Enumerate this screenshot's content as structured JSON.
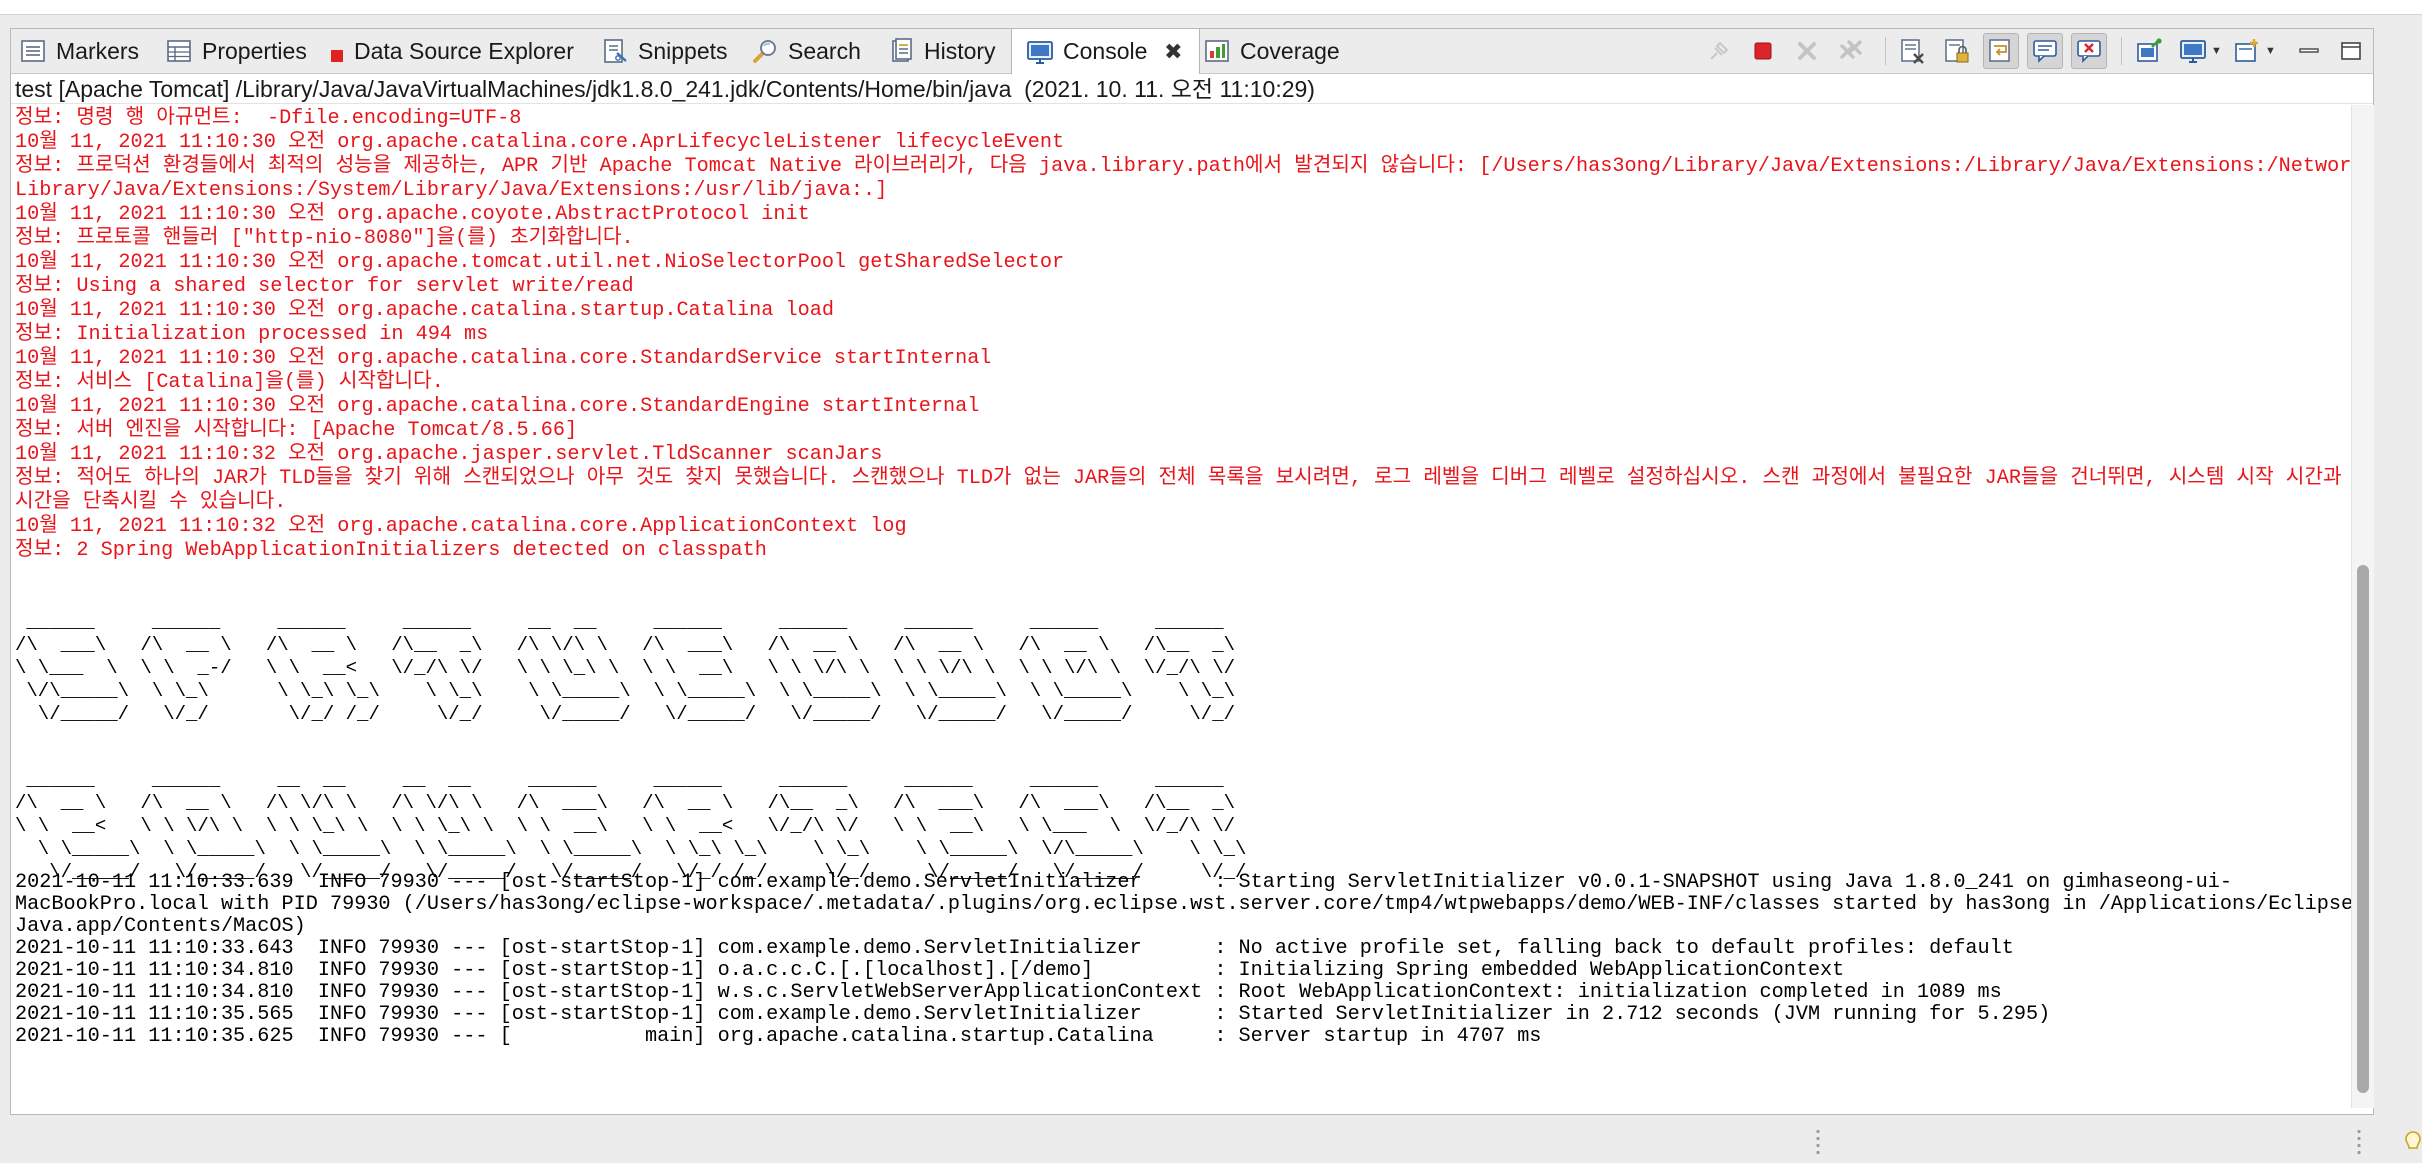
{
  "tabs": [
    {
      "label": "Markers",
      "icon": "markers-icon"
    },
    {
      "label": "Properties",
      "icon": "properties-icon"
    },
    {
      "label": "Data Source Explorer",
      "icon": "data-source-explorer-icon"
    },
    {
      "label": "Snippets",
      "icon": "snippets-icon"
    },
    {
      "label": "Search",
      "icon": "search-icon"
    },
    {
      "label": "History",
      "icon": "history-icon"
    },
    {
      "label": "Console",
      "icon": "console-icon",
      "active": true
    },
    {
      "label": "Coverage",
      "icon": "coverage-icon"
    }
  ],
  "toolbar": {
    "buttons": [
      "pin-console-icon",
      "terminate-icon",
      "remove-launch-icon",
      "remove-all-terminated-icon",
      "clear-console-icon",
      "scroll-lock-icon",
      "word-wrap-icon",
      "show-on-stdout-icon",
      "show-on-stderr-icon",
      "pin-icon",
      "display-selected-console-icon",
      "open-console-icon",
      "minimize-icon",
      "maximize-icon"
    ]
  },
  "process_line": "test [Apache Tomcat] /Library/Java/JavaVirtualMachines/jdk1.8.0_241.jdk/Contents/Home/bin/java  (2021. 10. 11. 오전 11:10:29)",
  "log_red": [
    "정보: 명령 행 아규먼트:  -Dfile.encoding=UTF-8",
    "10월 11, 2021 11:10:30 오전 org.apache.catalina.core.AprLifecycleListener lifecycleEvent",
    "정보: 프로덕션 환경들에서 최적의 성능을 제공하는, APR 기반 Apache Tomcat Native 라이브러리가, 다음 java.library.path에서 발견되지 않습니다: [/Users/has3ong/Library/Java/Extensions:/Library/Java/Extensions:/Network/",
    "Library/Java/Extensions:/System/Library/Java/Extensions:/usr/lib/java:.]",
    "10월 11, 2021 11:10:30 오전 org.apache.coyote.AbstractProtocol init",
    "정보: 프로토콜 핸들러 [\"http-nio-8080\"]을(를) 초기화합니다.",
    "10월 11, 2021 11:10:30 오전 org.apache.tomcat.util.net.NioSelectorPool getSharedSelector",
    "정보: Using a shared selector for servlet write/read",
    "10월 11, 2021 11:10:30 오전 org.apache.catalina.startup.Catalina load",
    "정보: Initialization processed in 494 ms",
    "10월 11, 2021 11:10:30 오전 org.apache.catalina.core.StandardService startInternal",
    "정보: 서비스 [Catalina]을(를) 시작합니다.",
    "10월 11, 2021 11:10:30 오전 org.apache.catalina.core.StandardEngine startInternal",
    "정보: 서버 엔진을 시작합니다: [Apache Tomcat/8.5.66]",
    "10월 11, 2021 11:10:32 오전 org.apache.jasper.servlet.TldScanner scanJars",
    "정보: 적어도 하나의 JAR가 TLD들을 찾기 위해 스캔되었으나 아무 것도 찾지 못했습니다. 스캔했으나 TLD가 없는 JAR들의 전체 목록을 보시려면, 로그 레벨을 디버그 레벨로 설정하십시오. 스캔 과정에서 불필요한 JAR들을 건너뛰면, 시스템 시작 시간과 JSP 컴파일",
    "시간을 단축시킬 수 있습니다.",
    "10월 11, 2021 11:10:32 오전 org.apache.catalina.core.ApplicationContext log",
    "정보: 2 Spring WebApplicationInitializers detected on classpath"
  ],
  "banner_1": " ______     ______     ______     ______     __  __     ______     ______     ______     ______     ______\n/\\  ___\\   /\\  __ \\   /\\  __ \\   /\\__  _\\   /\\ \\/\\ \\   /\\  ___\\   /\\  __ \\   /\\  __ \\   /\\  __ \\   /\\__  _\\\n\\ \\___  \\  \\ \\  _-/   \\ \\  __<   \\/_/\\ \\/   \\ \\ \\_\\ \\  \\ \\  __\\   \\ \\ \\/\\ \\  \\ \\ \\/\\ \\  \\ \\ \\/\\ \\  \\/_/\\ \\/\n \\/\\_____\\  \\ \\_\\      \\ \\_\\ \\_\\    \\ \\_\\    \\ \\_____\\  \\ \\_____\\  \\ \\_____\\  \\ \\_____\\  \\ \\_____\\    \\ \\_\\\n  \\/_____/   \\/_/       \\/_/ /_/     \\/_/     \\/_____/   \\/_____/   \\/_____/   \\/_____/   \\/_____/     \\/_/",
  "banner_2": " ______     ______     __  __     __  __     ______     ______     ______     ______     ______     ______\n/\\  __ \\   /\\  __ \\   /\\ \\/\\ \\   /\\ \\/\\ \\   /\\  ___\\   /\\  __ \\   /\\__  _\\   /\\  ___\\   /\\  ___\\   /\\__  _\\\n\\ \\  __<   \\ \\ \\/\\ \\  \\ \\ \\_\\ \\  \\ \\ \\_\\ \\  \\ \\  __\\   \\ \\  __<   \\/_/\\ \\/   \\ \\  __\\   \\ \\___  \\  \\/_/\\ \\/\n  \\ \\_____\\  \\ \\_____\\  \\ \\_____\\  \\ \\_____\\  \\ \\_____\\  \\ \\_\\ \\_\\    \\ \\_\\    \\ \\_____\\  \\/\\_____\\    \\ \\_\\\n   \\/_____/   \\/_____/   \\/_____/   \\/_____/   \\/_____/   \\/_/ /_/     \\/_/     \\/_____/   \\/_____/     \\/_/",
  "log_black": [
    "2021-10-11 11:10:33.639  INFO 79930 --- [ost-startStop-1] com.example.demo.ServletInitializer      : Starting ServletInitializer v0.0.1-SNAPSHOT using Java 1.8.0_241 on gimhaseong-ui-",
    "MacBookPro.local with PID 79930 (/Users/has3ong/eclipse-workspace/.metadata/.plugins/org.eclipse.wst.server.core/tmp4/wtpwebapps/demo/WEB-INF/classes started by has3ong in /Applications/Eclipse",
    "Java.app/Contents/MacOS)",
    "2021-10-11 11:10:33.643  INFO 79930 --- [ost-startStop-1] com.example.demo.ServletInitializer      : No active profile set, falling back to default profiles: default",
    "2021-10-11 11:10:34.810  INFO 79930 --- [ost-startStop-1] o.a.c.c.C.[.[localhost].[/demo]          : Initializing Spring embedded WebApplicationContext",
    "2021-10-11 11:10:34.810  INFO 79930 --- [ost-startStop-1] w.s.c.ServletWebServerApplicationContext : Root WebApplicationContext: initialization completed in 1089 ms",
    "2021-10-11 11:10:35.565  INFO 79930 --- [ost-startStop-1] com.example.demo.ServletInitializer      : Started ServletInitializer in 2.712 seconds (JVM running for 5.295)",
    "2021-10-11 11:10:35.625  INFO 79930 --- [           main] org.apache.catalina.startup.Catalina     : Server startup in 4707 ms"
  ],
  "colors": {
    "stderr": "#e8141a",
    "stdout": "#000000",
    "terminate": "#d9262b"
  }
}
